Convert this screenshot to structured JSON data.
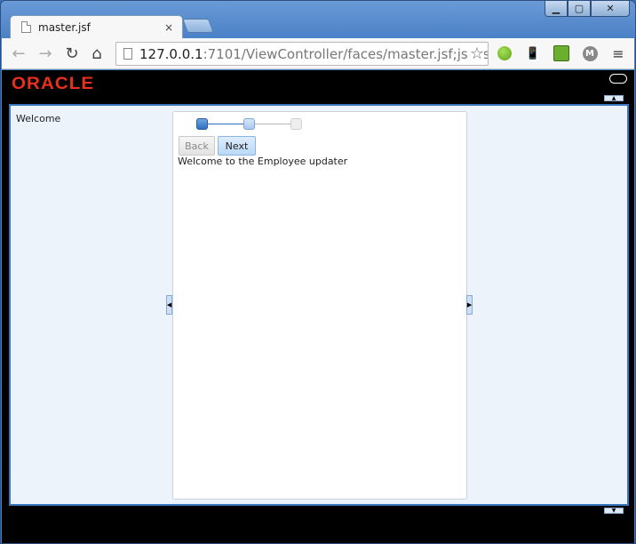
{
  "browser": {
    "tab_title": "master.jsf",
    "tab_close": "×",
    "url_host": "127.0.0.1",
    "url_rest": ":7101/ViewController/faces/master.jsf;jsessi",
    "icons": {
      "back": "back-arrow-icon",
      "forward": "forward-arrow-icon",
      "reload": "reload-icon",
      "home": "home-icon",
      "bookmark": "star-icon",
      "menu": "hamburger-menu-icon"
    }
  },
  "app": {
    "logo_text": "ORACLE",
    "left_label": "Welcome",
    "train": {
      "steps": 3,
      "current_step": 1
    },
    "buttons": {
      "back_label": "Back",
      "next_label": "Next"
    },
    "intro_text": "Welcome to the Employee updater"
  },
  "colors": {
    "oracle_red": "#e8301c",
    "panel_bg": "#edf3fb",
    "panel_border": "#3a79c0"
  }
}
